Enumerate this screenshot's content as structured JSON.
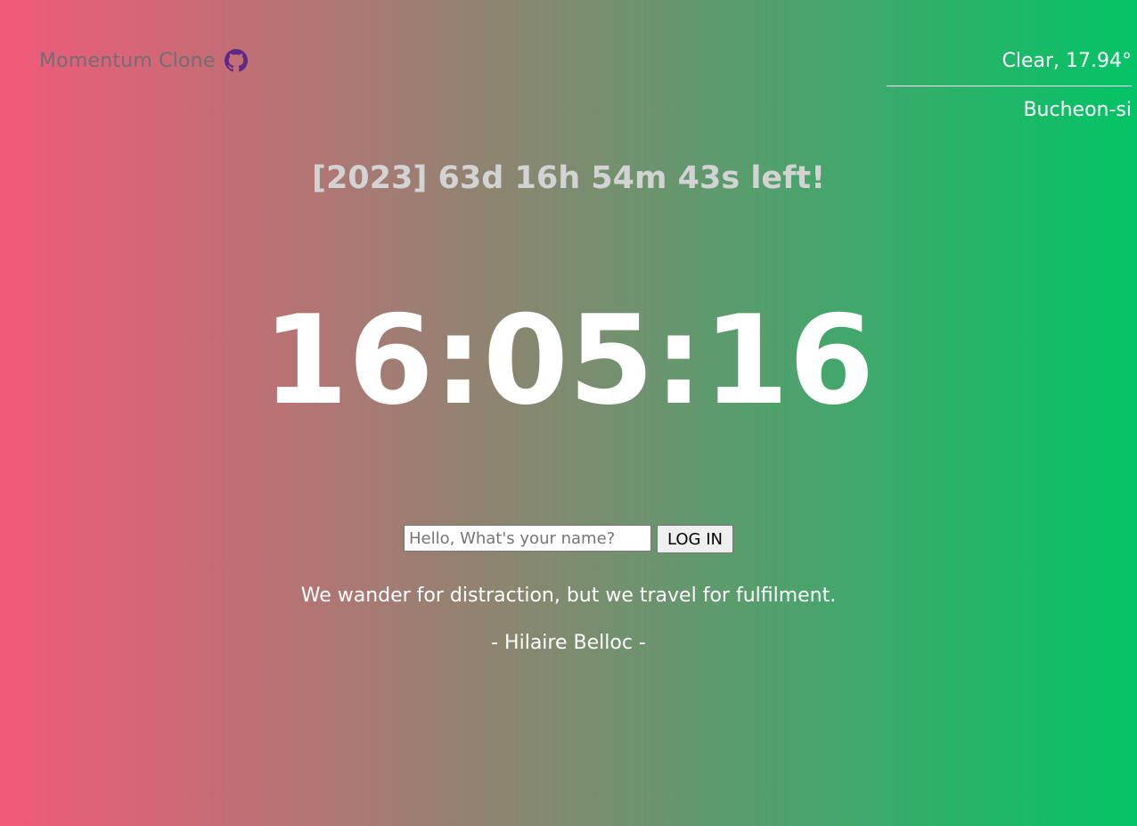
{
  "header": {
    "brand_name": "Momentum Clone",
    "github_icon": "github-icon",
    "github_icon_color": "#5b2a86"
  },
  "weather": {
    "description": "Clear, 17.94°",
    "city": "Bucheon-si"
  },
  "dday": {
    "text": "[2023] 63d 16h 54m 43s left!"
  },
  "clock": {
    "time": "16:05:16"
  },
  "login": {
    "placeholder": "Hello, What's your name?",
    "button_label": "LOG IN"
  },
  "quote": {
    "text": "We wander for distraction, but we travel for fulfilment.",
    "author": "- Hilaire Belloc -"
  },
  "colors": {
    "gradient_start": "#f25a7a",
    "gradient_end": "#03c466",
    "dday_text": "#d3d3d3",
    "brand_text": "#6f6f74"
  }
}
